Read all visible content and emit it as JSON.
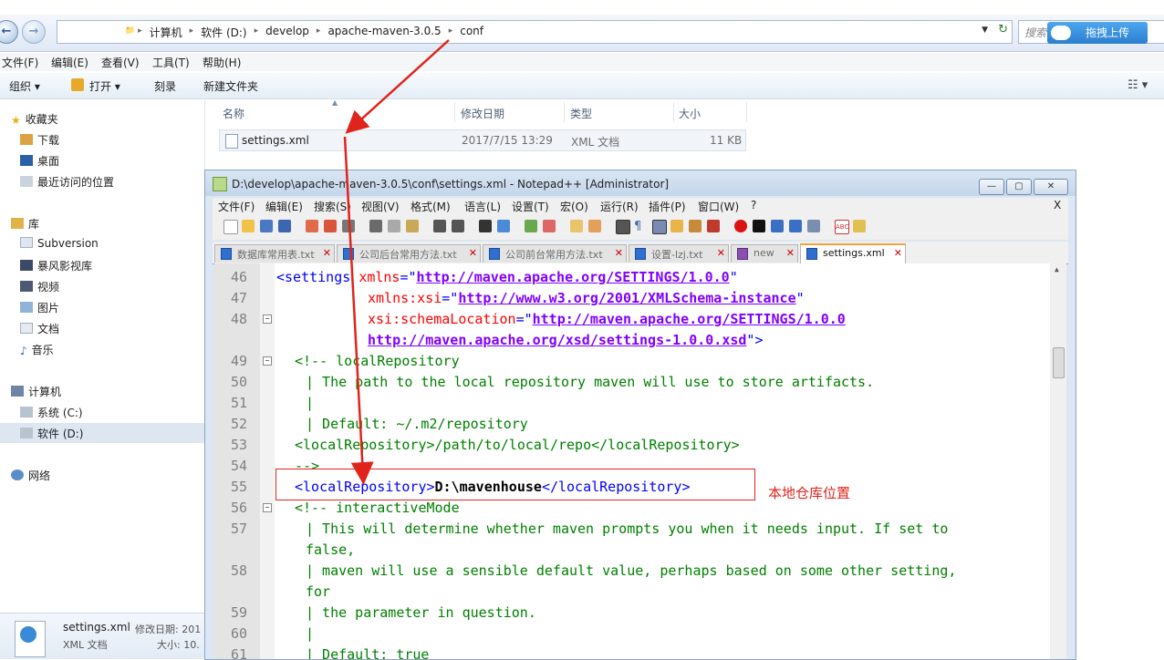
{
  "explorer": {
    "breadcrumbs": [
      "计算机",
      "软件 (D:)",
      "develop",
      "apache-maven-3.0.5",
      "conf"
    ],
    "search_placeholder": "搜索",
    "upload_button": "拖拽上传",
    "menu": [
      "文件(F)",
      "编辑(E)",
      "查看(V)",
      "工具(T)",
      "帮助(H)"
    ],
    "toolbar": [
      "组织 ▾",
      "打开 ▾",
      "刻录",
      "新建文件夹"
    ],
    "nav": {
      "favorites_header": "收藏夹",
      "favorites": [
        "下载",
        "桌面",
        "最近访问的位置"
      ],
      "library_header": "库",
      "library": [
        "Subversion",
        "暴风影视库",
        "视频",
        "图片",
        "文档",
        "音乐"
      ],
      "computer_header": "计算机",
      "drives": [
        "系统 (C:)",
        "软件 (D:)"
      ],
      "network": "网络"
    },
    "columns": [
      "名称",
      "修改日期",
      "类型",
      "大小"
    ],
    "file": {
      "name": "settings.xml",
      "date": "2017/7/15 13:29",
      "type": "XML 文档",
      "size": "11 KB"
    },
    "status": {
      "name": "settings.xml",
      "date_label": "修改日期: 201",
      "type": "XML 文档",
      "size_label": "大小: 10."
    }
  },
  "notepad": {
    "title": "D:\\develop\\apache-maven-3.0.5\\conf\\settings.xml - Notepad++ [Administrator]",
    "menu": [
      "文件(F)",
      "编辑(E)",
      "搜索(S)",
      "视图(V)",
      "格式(M)",
      "语言(L)",
      "设置(T)",
      "宏(O)",
      "运行(R)",
      "插件(P)",
      "窗口(W)",
      "?"
    ],
    "close_x": "X",
    "tabs": [
      "数据库常用表.txt",
      "公司后台常用方法.txt",
      "公司前台常用方法.txt",
      "设置-lzj.txt",
      "new",
      "settings.xml"
    ],
    "line_numbers": [
      "46",
      "47",
      "48",
      "49",
      "50",
      "51",
      "52",
      "53",
      "54",
      "55",
      "56",
      "57",
      "58",
      "59",
      "60",
      "61"
    ],
    "code": {
      "l46_tag": "<settings ",
      "l46_attr": "xmlns",
      "l46_eq": "=\"",
      "l46_val": "http://maven.apache.org/SETTINGS/1.0.0",
      "l46_end": "\"",
      "l47_attr": "xmlns:xsi",
      "l47_eq": "=\"",
      "l47_val": "http://www.w3.org/2001/XMLSchema-instance",
      "l47_end": "\"",
      "l48_attr": "xsi:schemaLocation",
      "l48_eq": "=\"",
      "l48_val": "http://maven.apache.org/SETTINGS/1.0.0",
      "l48b_val": "http://maven.apache.org/xsd/settings-1.0.0.xsd",
      "l48b_end": "\">",
      "l49": "<!-- localRepository",
      "l50": "| The path to the local repository maven will use to store artifacts.",
      "l51": "|",
      "l52": "| Default: ~/.m2/repository",
      "l53": "<localRepository>/path/to/local/repo</localRepository>",
      "l54": "-->",
      "l55_open": "<localRepository>",
      "l55_text": "D:\\mavenhouse",
      "l55_close": "</localRepository>",
      "l56": "<!-- interactiveMode",
      "l57": "| This will determine whether maven prompts you when it needs input. If set to",
      "l57b": "false,",
      "l58": "| maven will use a sensible default value, perhaps based on some other setting,",
      "l58b": "for",
      "l59": "| the parameter in question.",
      "l60": "|",
      "l61": "| Default: true"
    }
  },
  "annotation": "本地仓库位置",
  "colors": {
    "arrow": "#e0241b",
    "tag": "#0000ff",
    "attr": "#ff0000",
    "value": "#8000ff",
    "comment": "#008000"
  }
}
